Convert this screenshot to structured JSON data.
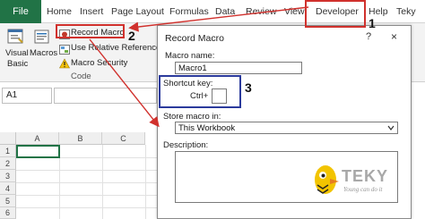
{
  "ribbon": {
    "tabs": [
      "File",
      "Home",
      "Insert",
      "Page Layout",
      "Formulas",
      "Data",
      "Review",
      "View",
      "Developer",
      "Help",
      "Teky"
    ],
    "commands": {
      "visual_basic_line1": "Visual",
      "visual_basic_line2": "Basic",
      "macros": "Macros",
      "record_macro": "Record Macro",
      "use_relative_references": "Use Relative References",
      "macro_security": "Macro Security",
      "group_label": "Code"
    }
  },
  "formula_bar": {
    "name_box": "A1",
    "fx": "fx"
  },
  "grid": {
    "columns": [
      "A",
      "B",
      "C"
    ],
    "rows": [
      "1",
      "2",
      "3",
      "4",
      "5",
      "6"
    ]
  },
  "dialog": {
    "title": "Record Macro",
    "help": "?",
    "close": "×",
    "macro_name_label": "Macro name:",
    "macro_name_value": "Macro1",
    "shortcut_label": "Shortcut key:",
    "ctrl_label": "Ctrl+",
    "shortcut_value": "",
    "store_label": "Store macro in:",
    "store_value": "This Workbook",
    "description_label": "Description:",
    "description_value": ""
  },
  "callouts": [
    "1",
    "2",
    "3"
  ],
  "watermark": {
    "brand": "TEKY",
    "tagline": "Young can do it"
  },
  "colors": {
    "file_tab": "#217346",
    "callout_red": "#d0312d",
    "callout_blue": "#2b3a9c",
    "teky_yellow": "#f2c400"
  }
}
